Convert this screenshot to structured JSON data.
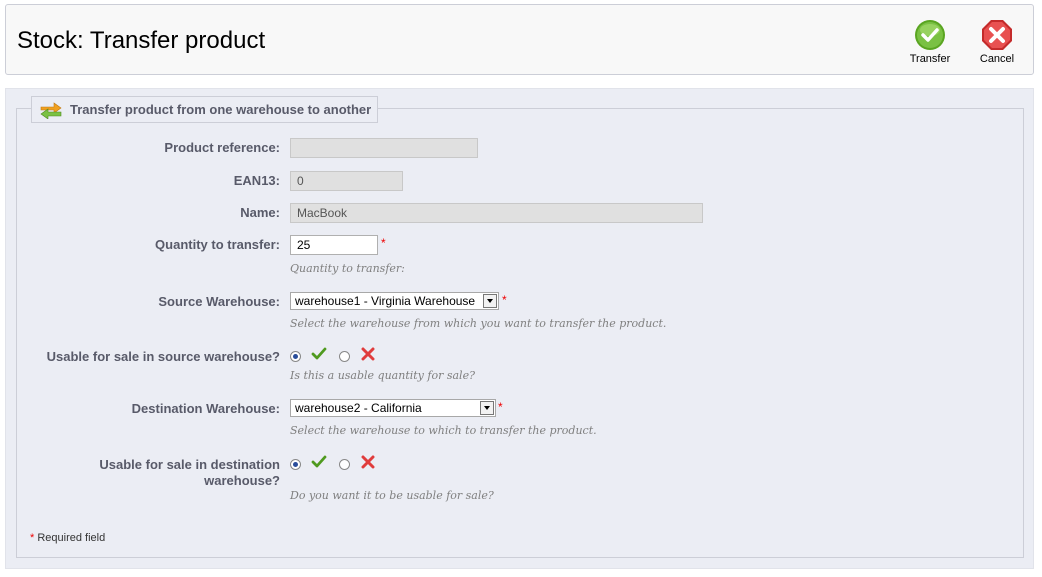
{
  "header": {
    "title": "Stock: Transfer product",
    "transfer_label": "Transfer",
    "cancel_label": "Cancel"
  },
  "form": {
    "legend": "Transfer product from one warehouse to another",
    "product_reference": {
      "label": "Product reference:",
      "value": ""
    },
    "ean13": {
      "label": "EAN13:",
      "value": "0"
    },
    "name": {
      "label": "Name:",
      "value": "MacBook"
    },
    "quantity": {
      "label": "Quantity to transfer:",
      "value": "25",
      "hint": "Quantity to transfer:"
    },
    "source_warehouse": {
      "label": "Source Warehouse:",
      "selected": "warehouse1 - Virginia Warehouse",
      "hint": "Select the warehouse from which you want to transfer the product."
    },
    "usable_source": {
      "label": "Usable for sale in source warehouse?",
      "selected": "yes",
      "hint": "Is this a usable quantity for sale?"
    },
    "destination_warehouse": {
      "label": "Destination Warehouse:",
      "selected": "warehouse2 - California",
      "hint": "Select the warehouse to which to transfer the product."
    },
    "usable_destination": {
      "label_line1": "Usable for sale in destination",
      "label_line2": "warehouse?",
      "selected": "yes",
      "hint": "Do you want it to be usable for sale?"
    },
    "required_star": "*",
    "required_note": "Required field"
  },
  "icons": {
    "transfer": "check-circle-icon",
    "cancel": "x-octagon-icon",
    "legend": "transfer-arrows-icon",
    "yes": "checkmark-icon",
    "no": "cross-icon"
  },
  "colors": {
    "accent_green": "#7ac143",
    "accent_red": "#e03c3c",
    "label_text": "#585a69",
    "panel_bg": "#ebedf4"
  }
}
